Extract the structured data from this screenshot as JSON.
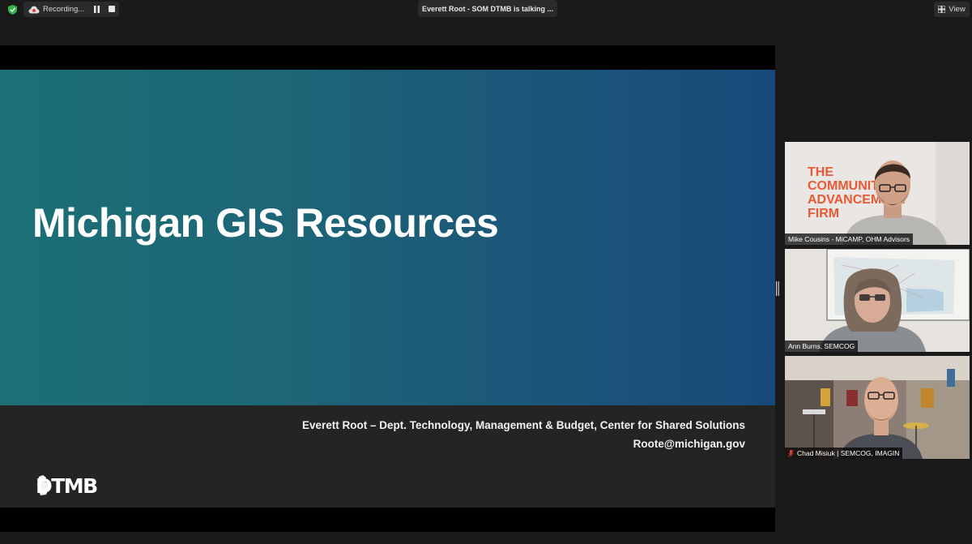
{
  "topbar": {
    "recording_label": "Recording...",
    "talking_text": "Everett Root - SOM DTMB is talking ...",
    "view_label": "View",
    "accent_green": "#33b24d",
    "icons": [
      "shield-check-icon",
      "cloud-icon",
      "pause-icon",
      "stop-icon",
      "grid-icon"
    ]
  },
  "slide": {
    "title": "Michigan GIS Resources",
    "presenter": "Everett Root – Dept. Technology, Management & Budget, Center for Shared Solutions",
    "email": "Roote@michigan.gov",
    "logo_text": "DTMB",
    "gradient_start": "#1c7076",
    "gradient_end": "#174a7a"
  },
  "participants": [
    {
      "name": "Mike Cousins - MiCAMP, OHM Advisors",
      "muted": false,
      "background_text": [
        "THE",
        "COMMUNITY",
        "ADVANCEMENT",
        "FIRM"
      ]
    },
    {
      "name": "Ann Burns, SEMCOG",
      "muted": false
    },
    {
      "name": "Chad Misiuk | SEMCOG, IMAGIN",
      "muted": true
    }
  ]
}
